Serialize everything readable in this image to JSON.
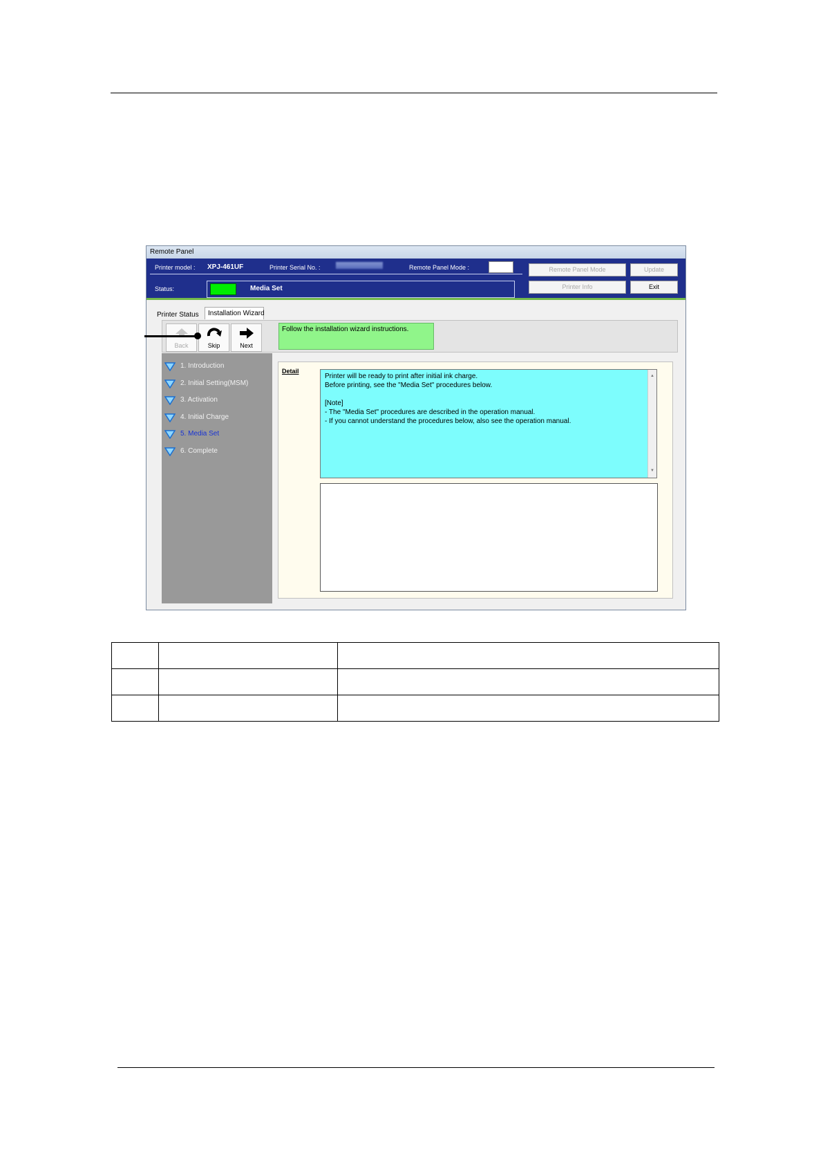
{
  "window": {
    "title": "Remote Panel",
    "header": {
      "printer_model_label": "Printer model :",
      "printer_model_value": "XPJ-461UF",
      "serial_label": "Printer Serial No. :",
      "remote_mode_label": "Remote Panel Mode :",
      "status_label": "Status:",
      "status_value": "Media Set",
      "status_color": "#00ee00"
    },
    "buttons": {
      "remote_panel_mode": "Remote Panel Mode",
      "update": "Update",
      "printer_info": "Printer Info",
      "exit": "Exit"
    },
    "tabs": [
      "Printer Status",
      "Installation Wizard"
    ],
    "toolbar": {
      "back": "Back",
      "skip": "Skip",
      "next": "Next",
      "message": "Follow the installation wizard instructions."
    },
    "steps": [
      {
        "label": "1. Introduction",
        "active": false
      },
      {
        "label": "2. Initial Setting(MSM)",
        "active": false
      },
      {
        "label": "3. Activation",
        "active": false
      },
      {
        "label": "4. Initial Charge",
        "active": false
      },
      {
        "label": "5. Media Set",
        "active": true
      },
      {
        "label": "6. Complete",
        "active": false
      }
    ],
    "detail": {
      "label": "Detail",
      "lines": [
        "Printer will be ready to print after initial ink charge.",
        "Before printing, see the \"Media Set\" procedures below.",
        "",
        "[Note]",
        "- The \"Media Set\" procedures are described in the operation manual.",
        "- If you cannot understand the procedures below, also see the operation manual."
      ]
    }
  },
  "legend_table": {
    "rows": [
      [
        "",
        "",
        ""
      ],
      [
        "",
        "",
        ""
      ],
      [
        "",
        "",
        ""
      ]
    ]
  }
}
